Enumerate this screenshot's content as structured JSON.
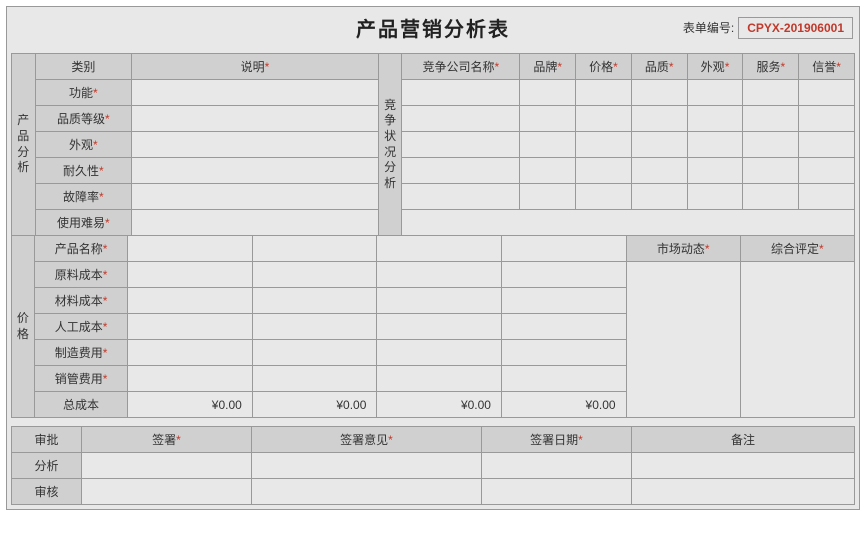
{
  "header": {
    "title": "产品营销分析表",
    "form_no_label": "表单编号:",
    "form_no_value": "CPYX-201906001"
  },
  "product_analysis": {
    "vlabel": "产品分析",
    "cols": {
      "category": "类别",
      "desc": "说明"
    },
    "rows": [
      "功能",
      "品质等级",
      "外观",
      "耐久性",
      "故障率",
      "使用难易"
    ]
  },
  "competition": {
    "vlabel": "竞争状况分析",
    "cols": [
      "竞争公司名称",
      "品牌",
      "价格",
      "品质",
      "外观",
      "服务",
      "信誉"
    ]
  },
  "price": {
    "vlabel": "价格",
    "cols": {
      "name": "产品名称"
    },
    "rows": [
      "原料成本",
      "材料成本",
      "人工成本",
      "制造费用",
      "销管费用"
    ],
    "total_label": "总成本",
    "totals": [
      "¥0.00",
      "¥0.00",
      "¥0.00",
      "¥0.00"
    ],
    "market_trend": "市场动态",
    "overall_eval": "综合评定"
  },
  "approval": {
    "header": [
      "审批",
      "签署",
      "签署意见",
      "签署日期",
      "备注"
    ],
    "rows": [
      "分析",
      "审核"
    ]
  },
  "asterisk": "*"
}
